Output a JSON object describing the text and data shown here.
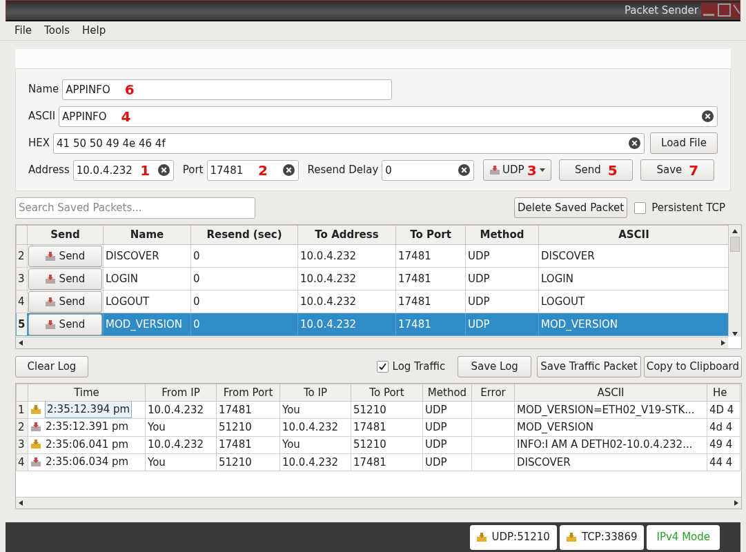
{
  "window": {
    "title": "Packet Sender"
  },
  "menu": [
    "File",
    "Tools",
    "Help"
  ],
  "packet_form": {
    "name": {
      "label": "Name",
      "value": "APPINFO",
      "marker": "6"
    },
    "ascii": {
      "label": "ASCII",
      "value": "APPINFO",
      "marker": "4"
    },
    "hex": {
      "label": "HEX",
      "value": "41 50 50 49 4e 46 4f"
    },
    "load_file_button": "Load File",
    "address": {
      "label": "Address",
      "value": "10.0.4.232",
      "marker": "1"
    },
    "port": {
      "label": "Port",
      "value": "17481",
      "marker": "2"
    },
    "resend_delay": {
      "label": "Resend Delay",
      "value": "0"
    },
    "method": {
      "value": "UDP",
      "marker": "3"
    },
    "send_button": {
      "label": "Send",
      "marker": "5"
    },
    "save_button": {
      "label": "Save",
      "marker": "7"
    }
  },
  "saved_packets": {
    "search": {
      "placeholder": "Search Saved Packets..."
    },
    "delete_button": "Delete Saved Packet",
    "persistent_tcp": {
      "label": "Persistent TCP",
      "checked": false
    },
    "columns": [
      "Send",
      "Name",
      "Resend (sec)",
      "To Address",
      "To Port",
      "Method",
      "ASCII"
    ],
    "rows": [
      {
        "index": "2",
        "send": "Send",
        "name": "DISCOVER",
        "resend": "0",
        "to_address": "10.0.4.232",
        "to_port": "17481",
        "method": "UDP",
        "ascii": "DISCOVER",
        "selected": false
      },
      {
        "index": "3",
        "send": "Send",
        "name": "LOGIN",
        "resend": "0",
        "to_address": "10.0.4.232",
        "to_port": "17481",
        "method": "UDP",
        "ascii": "LOGIN",
        "selected": false
      },
      {
        "index": "4",
        "send": "Send",
        "name": "LOGOUT",
        "resend": "0",
        "to_address": "10.0.4.232",
        "to_port": "17481",
        "method": "UDP",
        "ascii": "LOGOUT",
        "selected": false
      },
      {
        "index": "5",
        "send": "Send",
        "name": "MOD_VERSION",
        "resend": "0",
        "to_address": "10.0.4.232",
        "to_port": "17481",
        "method": "UDP",
        "ascii": "MOD_VERSION",
        "selected": true
      }
    ]
  },
  "log": {
    "clear_button": "Clear Log",
    "log_traffic": {
      "label": "Log Traffic",
      "checked": true
    },
    "save_log_button": "Save Log",
    "save_traffic_button": "Save Traffic Packet",
    "copy_button": "Copy to Clipboard",
    "columns": [
      "Time",
      "From IP",
      "From Port",
      "To IP",
      "To Port",
      "Method",
      "Error",
      "ASCII",
      "He"
    ],
    "rows": [
      {
        "index": "1",
        "kind": "received",
        "time": "2:35:12.394 pm",
        "from_ip": "10.0.4.232",
        "from_port": "17481",
        "to_ip": "You",
        "to_port": "51210",
        "method": "UDP",
        "ascii": "MOD_VERSION=ETH02_V19-STK...",
        "hex": "4D 4",
        "focused": true
      },
      {
        "index": "2",
        "kind": "sent",
        "time": "2:35:12.391 pm",
        "from_ip": "You",
        "from_port": "51210",
        "to_ip": "10.0.4.232",
        "to_port": "17481",
        "method": "UDP",
        "ascii": "MOD_VERSION",
        "hex": "4d 4",
        "focused": false
      },
      {
        "index": "3",
        "kind": "received",
        "time": "2:35:06.041 pm",
        "from_ip": "10.0.4.232",
        "from_port": "17481",
        "to_ip": "You",
        "to_port": "51210",
        "method": "UDP",
        "ascii": "INFO:I AM A DETH02-10.0.4.232...",
        "hex": "49 4",
        "focused": false
      },
      {
        "index": "4",
        "kind": "sent",
        "time": "2:35:06.034 pm",
        "from_ip": "You",
        "from_port": "51210",
        "to_ip": "10.0.4.232",
        "to_port": "17481",
        "method": "UDP",
        "ascii": "DISCOVER",
        "hex": "44 4",
        "focused": false
      }
    ]
  },
  "status_bar": {
    "udp": "UDP:51210",
    "tcp": "TCP:33869",
    "mode": "IPv4 Mode"
  }
}
